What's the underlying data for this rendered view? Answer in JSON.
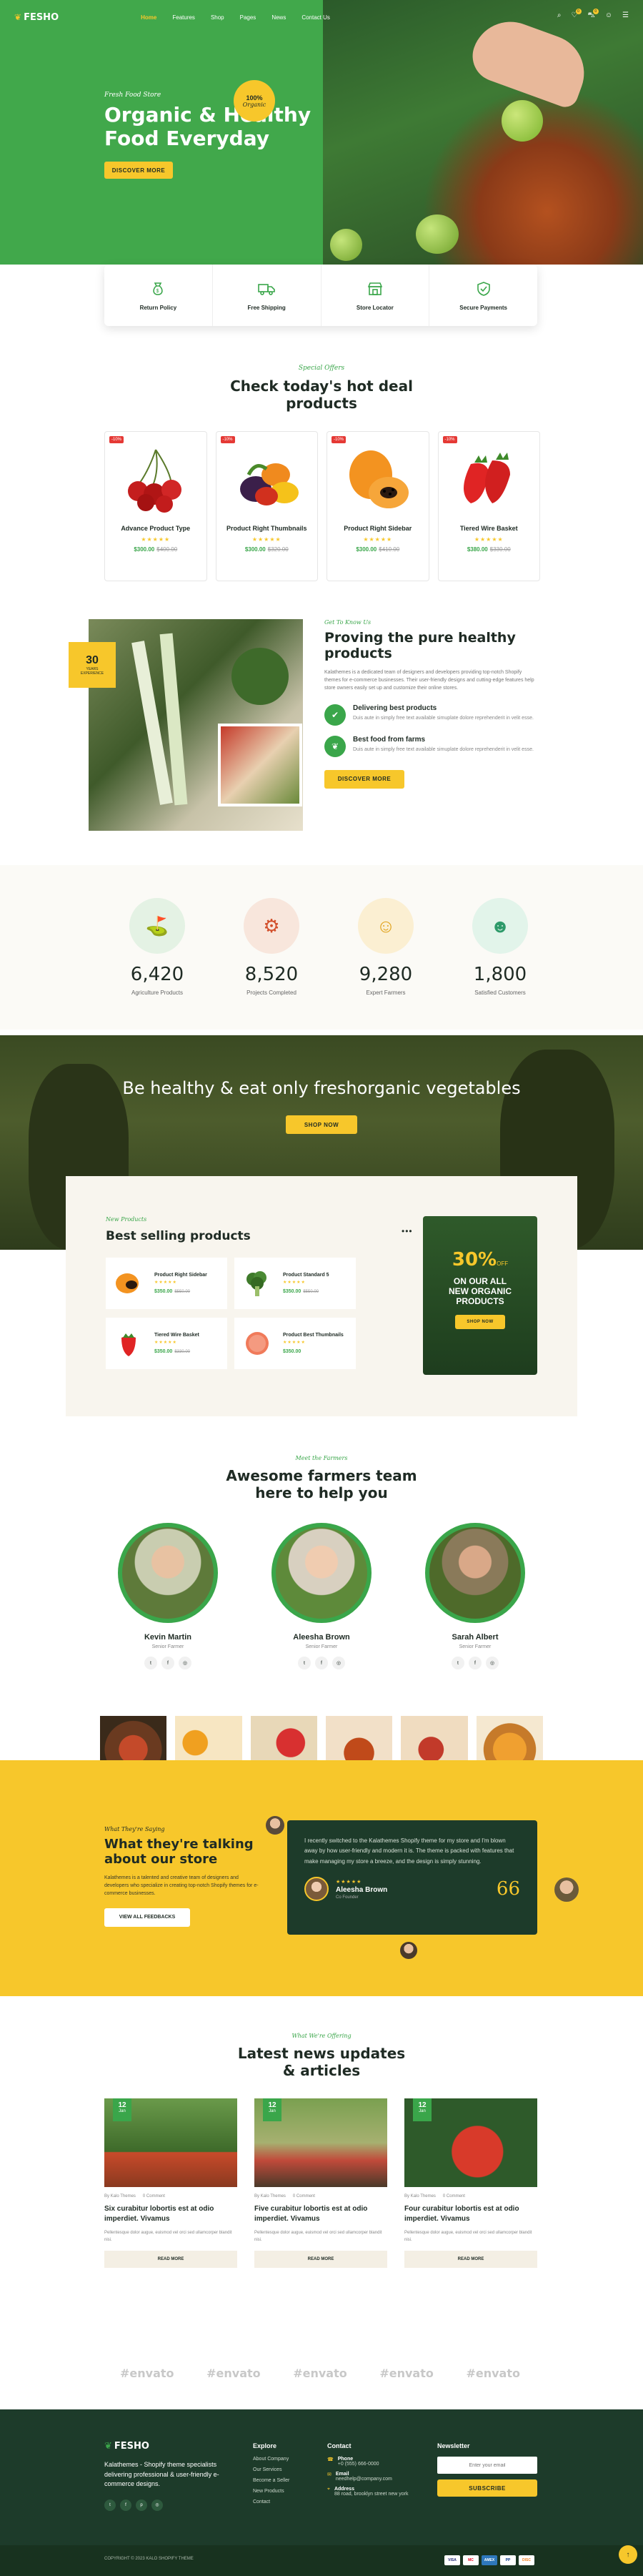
{
  "header": {
    "logo": "FESHO",
    "nav": [
      "Home",
      "Features",
      "Shop",
      "Pages",
      "News",
      "Contact Us"
    ],
    "cart_count": "0",
    "wish_count": "0"
  },
  "hero": {
    "script_text": "Fresh Food Store",
    "title_line1": "Organic & Healthy",
    "title_line2": "Food Everyday",
    "badge_line1": "100%",
    "badge_line2": "Organic",
    "button": "Discover More"
  },
  "features": [
    {
      "label": "Return Policy",
      "icon": "money-bag-icon"
    },
    {
      "label": "Free Shipping",
      "icon": "truck-icon"
    },
    {
      "label": "Store Locator",
      "icon": "store-icon"
    },
    {
      "label": "Secure Payments",
      "icon": "shield-icon"
    }
  ],
  "deals": {
    "eyebrow": "Special Offers",
    "title_line1": "Check today's hot deal",
    "title_line2": "products",
    "products": [
      {
        "name": "Advance Product Type",
        "badge": "-10%",
        "price": "$300.00",
        "old": "$400.00",
        "image": "cherries"
      },
      {
        "name": "Product Right Thumbnails",
        "badge": "-10%",
        "price": "$300.00",
        "old": "$320.00",
        "image": "vegetables"
      },
      {
        "name": "Product Right Sidebar",
        "badge": "-10%",
        "price": "$300.00",
        "old": "$410.00",
        "image": "papaya"
      },
      {
        "name": "Tiered Wire Basket",
        "badge": "-10%",
        "price": "$380.00",
        "old": "$330.00",
        "image": "strawberries"
      }
    ]
  },
  "about": {
    "years_num": "30",
    "years_label": "YEARS EXPERIENCE",
    "eyebrow": "Get To Know Us",
    "title_line1": "Proving the pure healthy",
    "title_line2": "products",
    "text": "Kalathemes is a dedicated team of designers and developers providing top-notch Shopify themes for e-commerce businesses. Their user-friendly designs and cutting-edge features help store owners easily set up and customize their online stores.",
    "item1_title": "Delivering best products",
    "item1_text": "Duis aute in simply free text available simuplate dolore reprehenderit in velit esse.",
    "item2_title": "Best food from farms",
    "item2_text": "Duis aute in simply free text available simuplate dolore reprehenderit in velit esse.",
    "button": "Discover More"
  },
  "stats": [
    {
      "value": "6,420",
      "label": "Agriculture Products",
      "icon": "basket-icon"
    },
    {
      "value": "8,520",
      "label": "Projects Completed",
      "icon": "tractor-icon"
    },
    {
      "value": "9,280",
      "label": "Expert Farmers",
      "icon": "farmer-icon"
    },
    {
      "value": "1,800",
      "label": "Satisfied Customers",
      "icon": "customer-icon"
    }
  ],
  "banner": {
    "title": "Be healthy & eat only freshorganic vegetables",
    "button": "Shop Now"
  },
  "bestselling": {
    "eyebrow": "New Products",
    "title": "Best selling products",
    "items": [
      {
        "name": "Product Right Sidebar",
        "price": "$350.00",
        "old": "$550.00",
        "image": "papaya"
      },
      {
        "name": "Product Standard 5",
        "price": "$350.00",
        "old": "$550.00",
        "image": "broccoli"
      },
      {
        "name": "Tiered Wire Basket",
        "price": "$350.00",
        "old": "$330.00",
        "image": "strawberry"
      },
      {
        "name": "Product Best Thumbnails",
        "price": "$350.00",
        "old": "",
        "image": "grapefruit"
      }
    ],
    "promo_pct": "30%",
    "promo_off": "OFF",
    "promo_line1": "ON OUR ALL",
    "promo_line2": "NEW ORGANIC",
    "promo_line3": "PRODUCTS",
    "promo_button": "Shop Now"
  },
  "team": {
    "eyebrow": "Meet the Farmers",
    "title_line1": "Awesome farmers team",
    "title_line2": "here to help you",
    "members": [
      {
        "name": "Kevin Martin",
        "role": "Senior Farmer"
      },
      {
        "name": "Aleesha Brown",
        "role": "Senior Farmer"
      },
      {
        "name": "Sarah Albert",
        "role": "Senior Farmer"
      }
    ]
  },
  "testimonial": {
    "eyebrow": "What They're Saying",
    "title_line1": "What they're talking",
    "title_line2": "about our store",
    "text": "Kalathemes is a talented and creative team of designers and developers who specialize in creating top-notch Shopify themes for e-commerce businesses.",
    "button": "View All Feedbacks",
    "quote": "I recently switched to the Kalathemes Shopify theme for my store and I'm blown away by how user-friendly and modern it is. The theme is packed with features that make managing my store a breeze, and the design is simply stunning.",
    "author": "Aleesha Brown",
    "role": "Co Founder"
  },
  "news": {
    "eyebrow": "What We're Offering",
    "title_line1": "Latest news updates",
    "title_line2": "& articles",
    "posts": [
      {
        "day": "12",
        "month": "Jan",
        "author": "By Kalo Themes",
        "comments": "0 Comment",
        "title": "Six curabitur lobortis est at odio imperdiet. Vivamus",
        "excerpt": "Pellentesque dolor augue, euismod vel orci sed ullamcorper blandit nisi.",
        "button": "Read More"
      },
      {
        "day": "12",
        "month": "Jan",
        "author": "By Kalo Themes",
        "comments": "0 Comment",
        "title": "Five curabitur lobortis est at odio imperdiet. Vivamus",
        "excerpt": "Pellentesque dolor augue, euismod vel orci sed ullamcorper blandit nisi.",
        "button": "Read More"
      },
      {
        "day": "12",
        "month": "Jan",
        "author": "By Kalo Themes",
        "comments": "0 Comment",
        "title": "Four curabitur lobortis est at odio imperdiet. Vivamus",
        "excerpt": "Pellentesque dolor augue, euismod vel orci sed ullamcorper blandit nisi.",
        "button": "Read More"
      }
    ]
  },
  "brands": [
    "#envato",
    "#envato",
    "#envato",
    "#envato",
    "#envato"
  ],
  "footer": {
    "logo": "FESHO",
    "about": "Kalathemes - Shopify theme specialists delivering professional & user-friendly e-commerce designs.",
    "explore_title": "Explore",
    "explore": [
      "About Company",
      "Our Services",
      "Become a Seller",
      "New Products",
      "Contact"
    ],
    "contact_title": "Contact",
    "phone_label": "Phone",
    "phone": "+0 (555) 666-0000",
    "email_label": "Email",
    "email": "needhelp@company.com",
    "address_label": "Address",
    "address": "88 road, brooklyn street new york",
    "newsletter_title": "Newsletter",
    "newsletter_placeholder": "Enter your email",
    "subscribe": "Subscribe",
    "copyright": "COPYRIGHT © 2023 KALO SHOPIFY THEME",
    "payments": [
      "VISA",
      "MC",
      "AMEX",
      "PP",
      "DISC"
    ]
  },
  "colors": {
    "green": "#3aa64a",
    "dark": "#1d3b2a",
    "yellow": "#f7c72b"
  }
}
